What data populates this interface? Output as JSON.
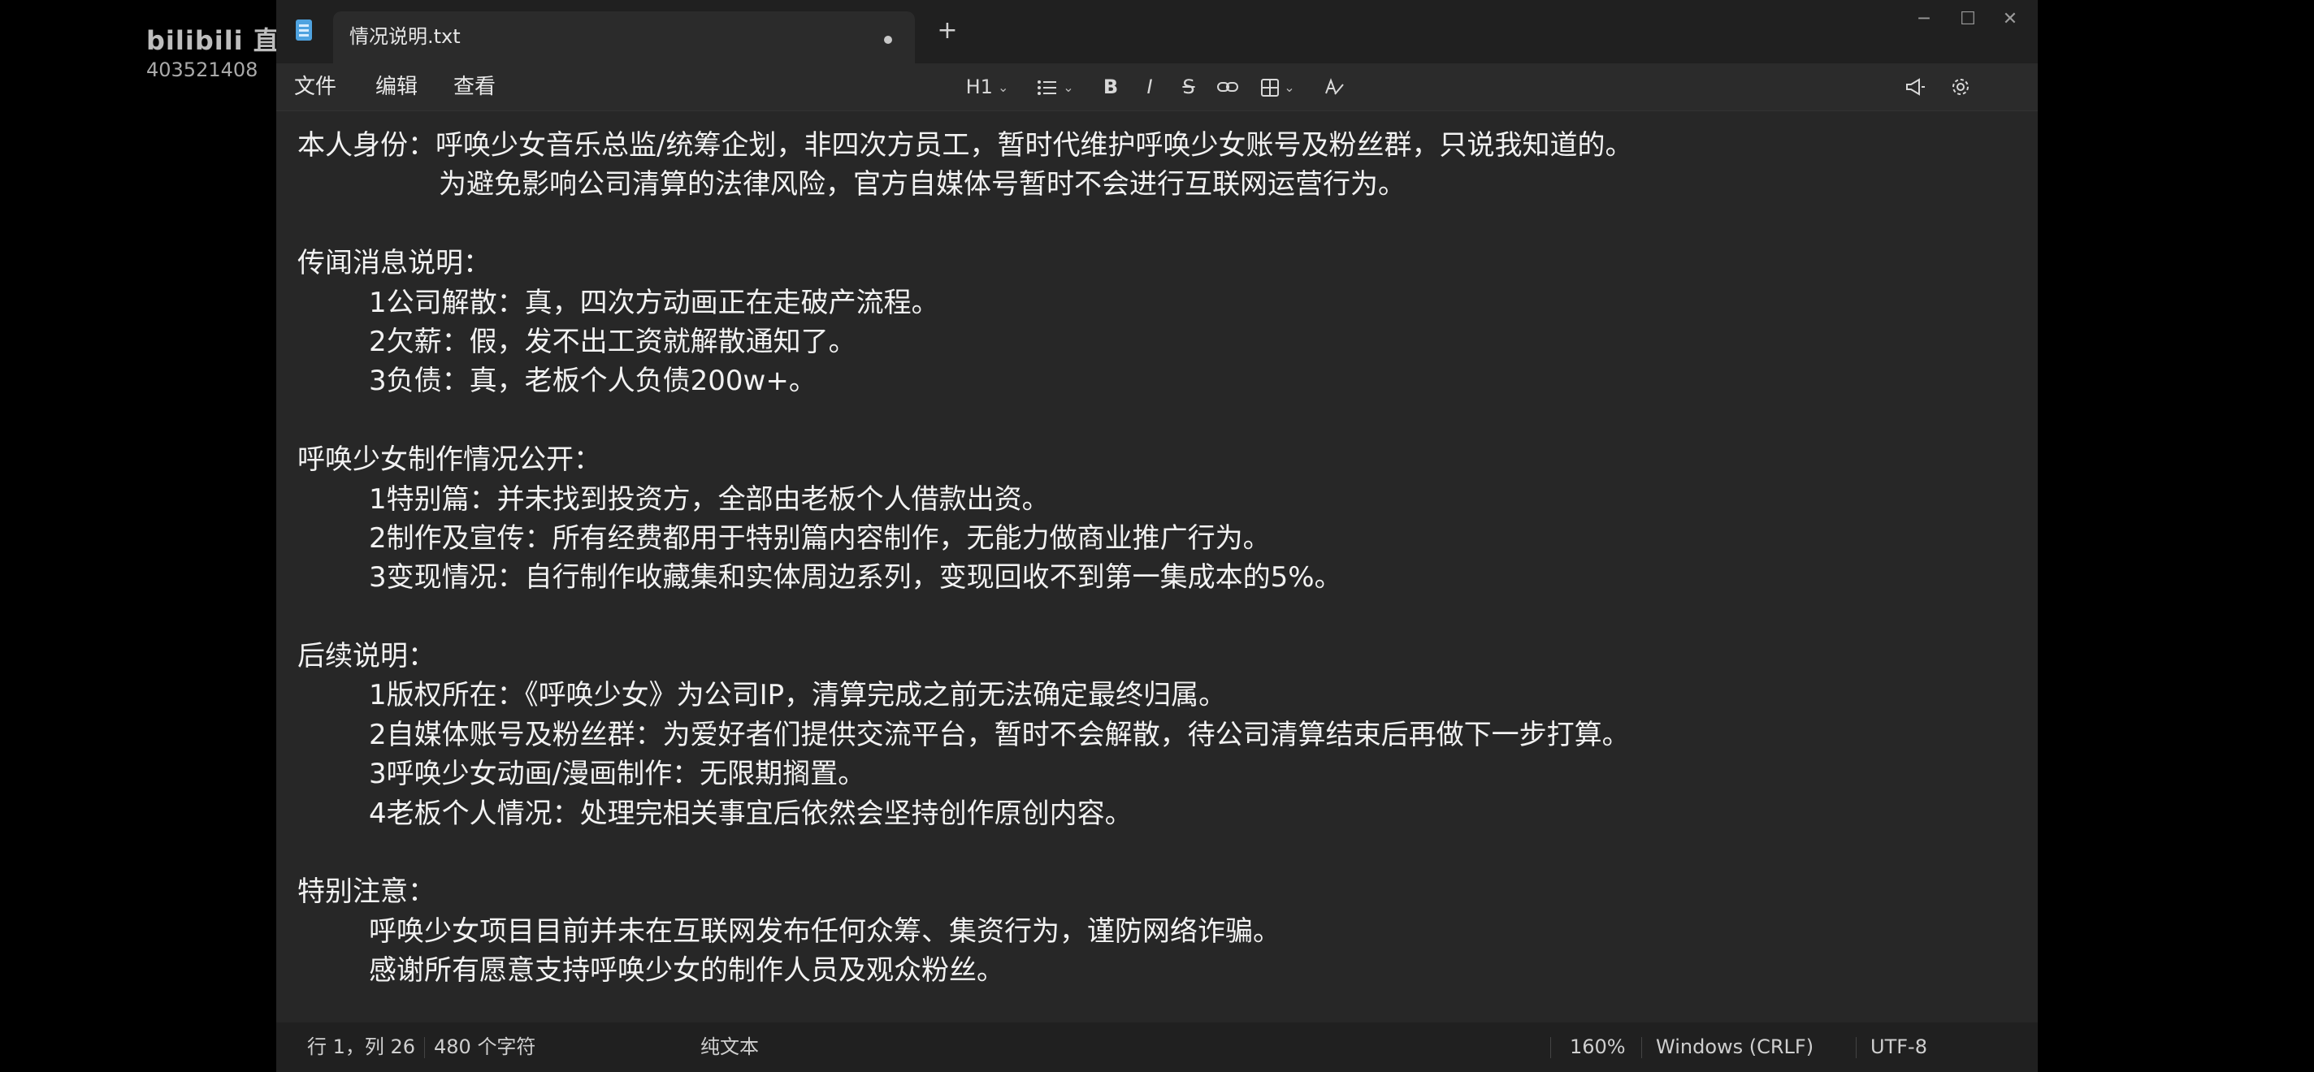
{
  "watermark": {
    "brand": "bilibili 直播",
    "room_id": "403521408"
  },
  "window": {
    "tab_title": "情况说明.txt",
    "new_tab": "+",
    "controls": {
      "minimize": "─",
      "maximize": "☐",
      "close": "✕"
    }
  },
  "menu": {
    "file": "文件",
    "edit": "编辑",
    "view": "查看"
  },
  "toolbar": {
    "heading": "H1",
    "bold": "B",
    "italic": "I",
    "strike": "S"
  },
  "document": {
    "lines": [
      "本人身份：呼唤少女音乐总监/统筹企划，非四次方员工，暂时代维护呼唤少女账号及粉丝群，只说我知道的。",
      "为避免影响公司清算的法律风险，官方自媒体号暂时不会进行互联网运营行为。",
      "",
      "传闻消息说明：",
      "1公司解散：真，四次方动画正在走破产流程。",
      "2欠薪：假，发不出工资就解散通知了。",
      "3负债：真，老板个人负债200w+。",
      "",
      "呼唤少女制作情况公开：",
      "1特别篇：并未找到投资方，全部由老板个人借款出资。",
      "2制作及宣传：所有经费都用于特别篇内容制作，无能力做商业推广行为。",
      "3变现情况：自行制作收藏集和实体周边系列，变现回收不到第一集成本的5%。",
      "",
      "后续说明：",
      "1版权所在：《呼唤少女》为公司IP，清算完成之前无法确定最终归属。",
      "2自媒体账号及粉丝群：为爱好者们提供交流平台，暂时不会解散，待公司清算结束后再做下一步打算。",
      "3呼唤少女动画/漫画制作：无限期搁置。",
      "4老板个人情况：处理完相关事宜后依然会坚持创作原创内容。",
      "",
      "特别注意：",
      "呼唤少女项目目前并未在互联网发布任何众筹、集资行为，谨防网络诈骗。",
      "感谢所有愿意支持呼唤少女的制作人员及观众粉丝。"
    ]
  },
  "status": {
    "cursor": "行 1，列 26",
    "char_count": "480 个字符",
    "format": "纯文本",
    "zoom": "160%",
    "line_ending": "Windows (CRLF)",
    "encoding": "UTF-8"
  }
}
